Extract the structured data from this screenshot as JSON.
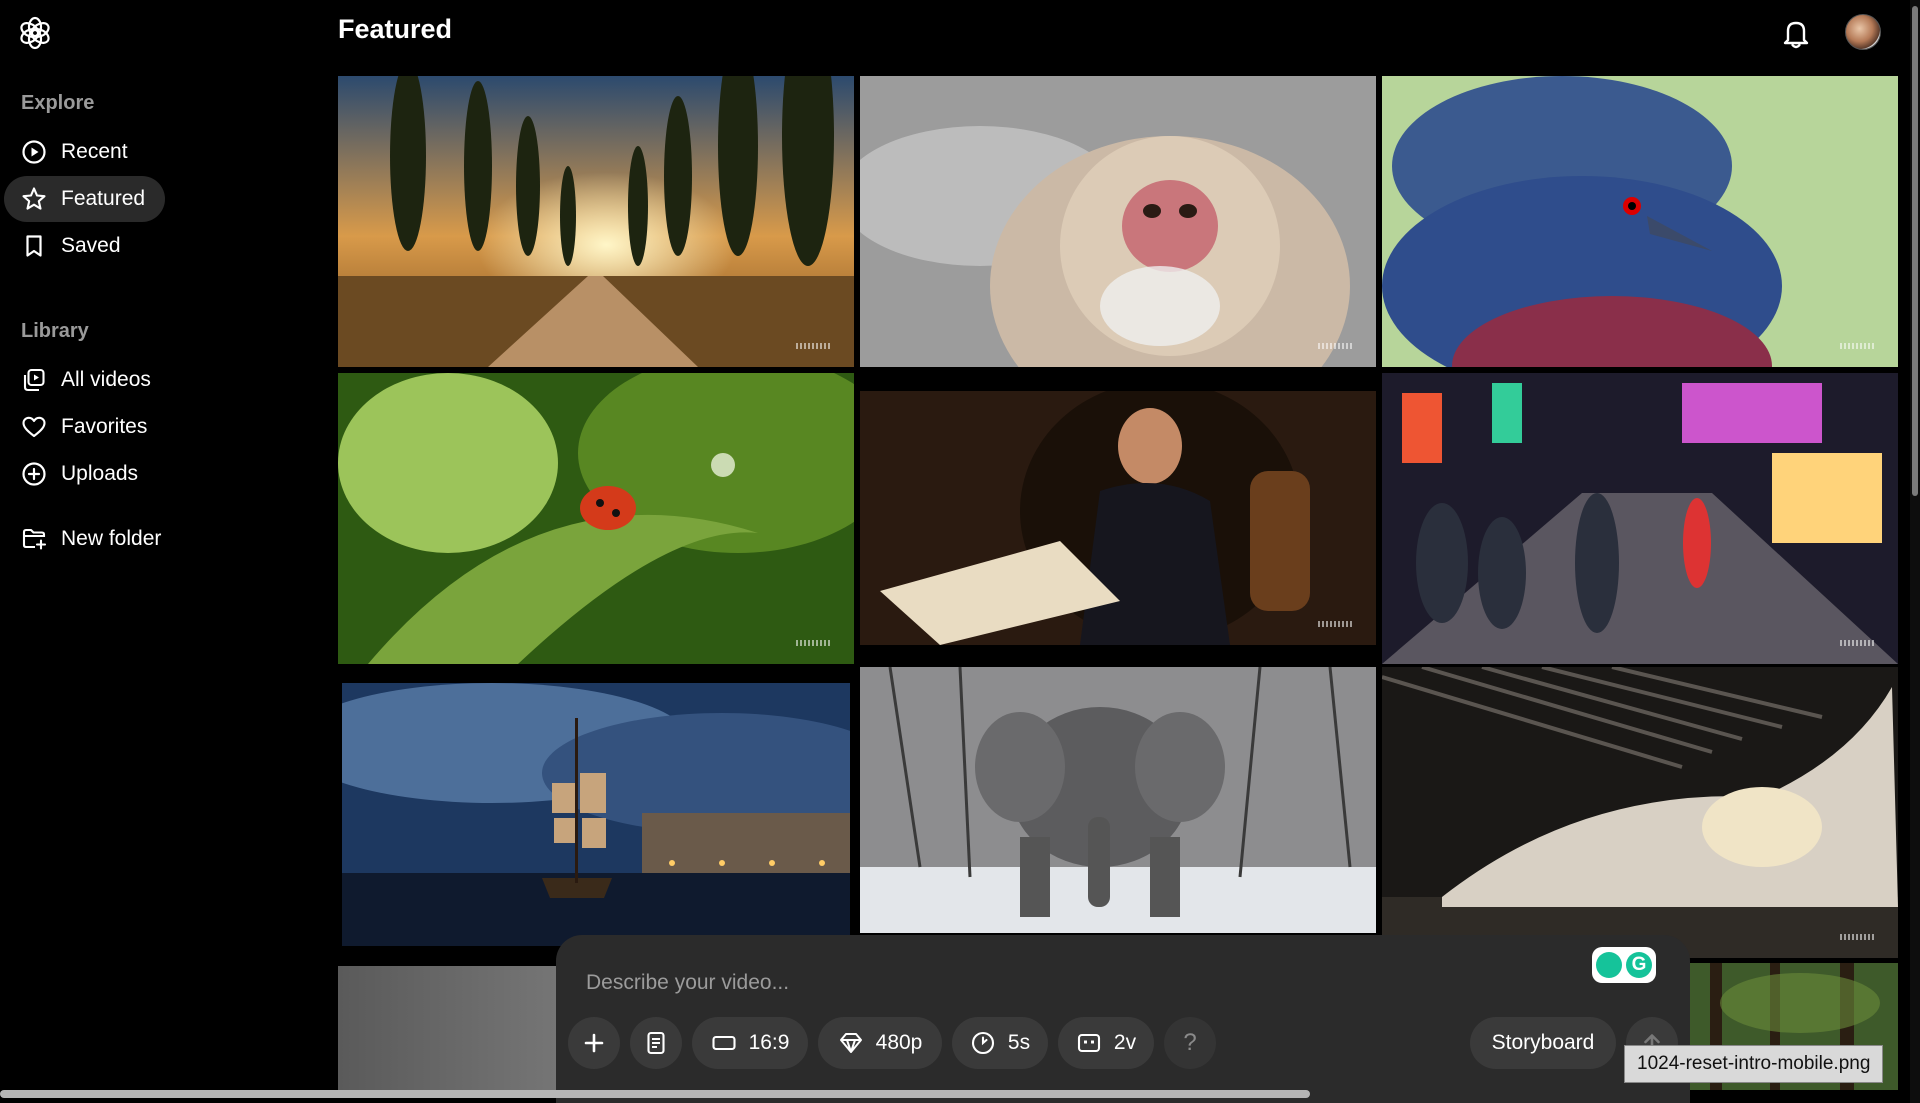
{
  "sidebar": {
    "explore_title": "Explore",
    "library_title": "Library",
    "explore_items": [
      {
        "label": "Recent",
        "icon": "play-circle-icon"
      },
      {
        "label": "Featured",
        "icon": "star-icon",
        "active": true
      },
      {
        "label": "Saved",
        "icon": "bookmark-icon"
      }
    ],
    "library_items": [
      {
        "label": "All videos",
        "icon": "video-stack-icon"
      },
      {
        "label": "Favorites",
        "icon": "heart-icon"
      },
      {
        "label": "Uploads",
        "icon": "plus-circle-icon"
      }
    ],
    "new_folder_label": "New folder"
  },
  "header": {
    "title": "Featured"
  },
  "composer": {
    "placeholder": "Describe your video...",
    "aspect_ratio": "16:9",
    "resolution": "480p",
    "duration": "5s",
    "variations": "2v",
    "help": "?",
    "storyboard_label": "Storyboard"
  },
  "tooltip": {
    "text": "1024-reset-intro-mobile.png"
  },
  "colors": {
    "background": "#000000",
    "active_nav": "#2a2a2a",
    "composer_bg": "#2b2b2b",
    "pill_bg": "#3a3a3a",
    "section_title": "#9a9a9a"
  }
}
